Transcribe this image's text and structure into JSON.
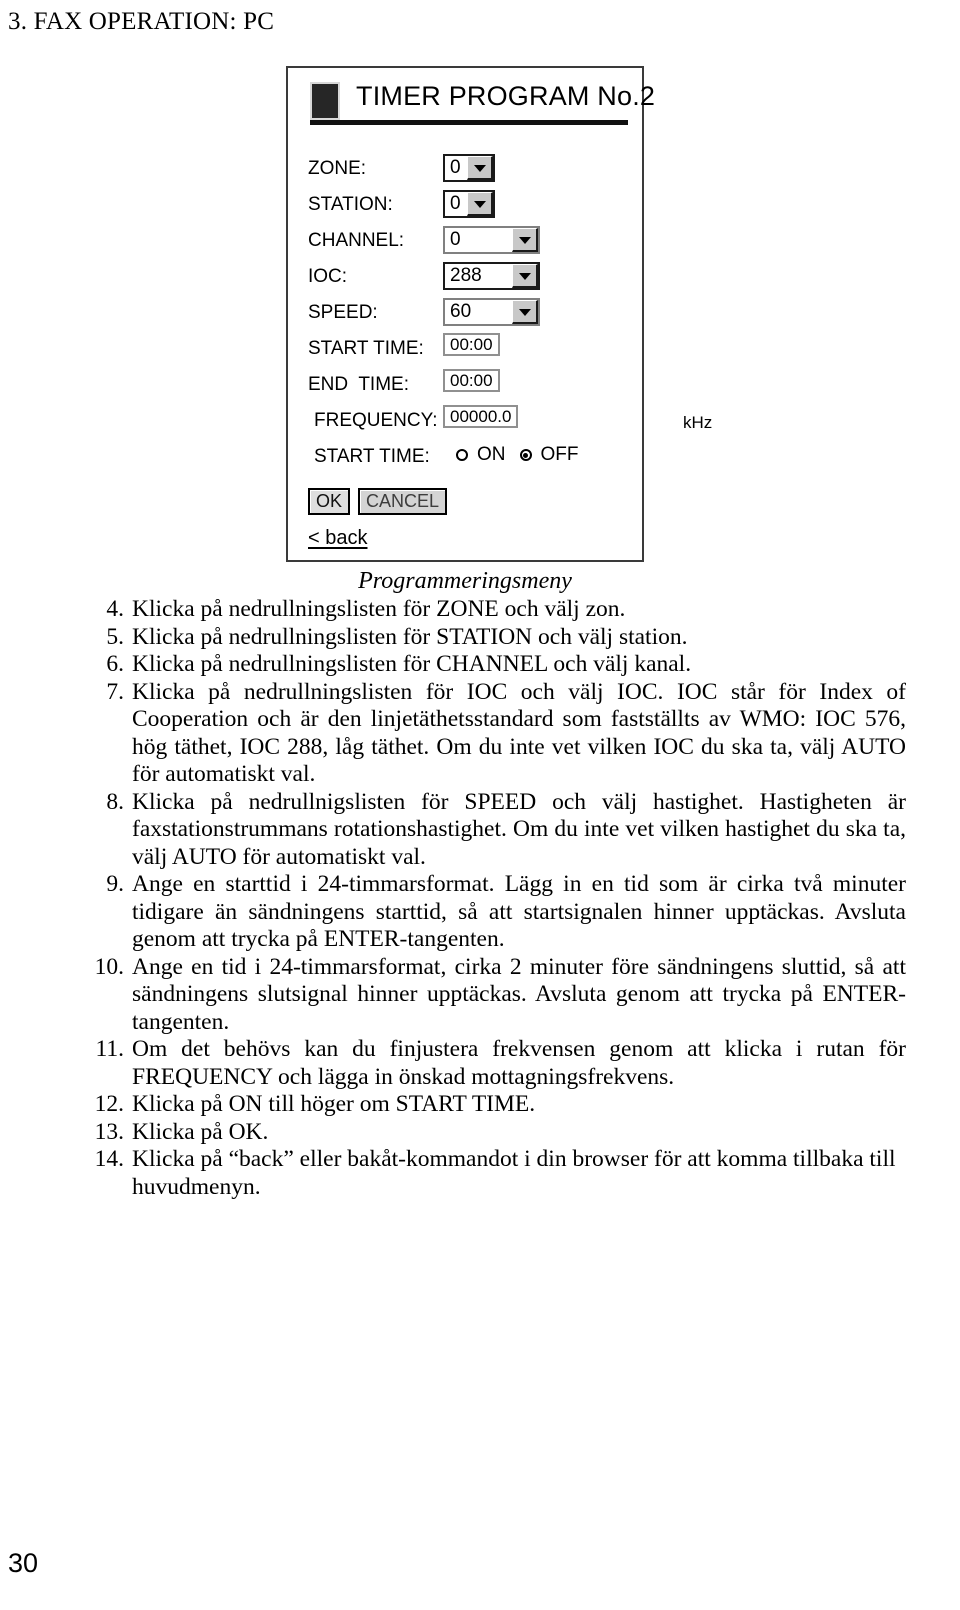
{
  "running_head": "3. FAX OPERATION: PC",
  "dialog": {
    "title": "TIMER PROGRAM No.2",
    "fields": [
      {
        "label": "ZONE:",
        "value": "0",
        "type": "combo-sm"
      },
      {
        "label": "STATION:",
        "value": "0",
        "type": "combo-sm"
      },
      {
        "label": "CHANNEL:",
        "value": "0",
        "type": "combo-lg"
      },
      {
        "label": "IOC:",
        "value": "288",
        "type": "combo-lg"
      },
      {
        "label": "SPEED:",
        "value": "60",
        "type": "combo-lg"
      },
      {
        "label": "START TIME:",
        "value": "00:00",
        "type": "textbox-time"
      },
      {
        "label": "END  TIME:",
        "value": "00:00",
        "type": "textbox-time"
      },
      {
        "label": "FREQUENCY:",
        "value": "00000.0",
        "unit": "kHz",
        "type": "textbox-freq"
      }
    ],
    "radio_row": {
      "label": "START TIME:",
      "options": [
        {
          "label": "ON",
          "selected": false
        },
        {
          "label": "OFF",
          "selected": true
        }
      ]
    },
    "buttons": {
      "ok": "OK",
      "cancel": "CANCEL"
    },
    "back_link": "< back"
  },
  "caption": "Programmeringsmeny",
  "steps": [
    {
      "num": "4.",
      "text": "Klicka på nedrullningslisten för ZONE och välj zon."
    },
    {
      "num": "5.",
      "text": "Klicka på nedrullningslisten för STATION och välj station."
    },
    {
      "num": "6.",
      "text": "Klicka på nedrullningslisten för CHANNEL och välj kanal."
    },
    {
      "num": "7.",
      "text": "Klicka på nedrullningslisten för IOC och välj IOC. IOC står för Index of Cooperation och är den linjetäthetsstandard som fastställts av WMO: IOC 576, hög täthet, IOC 288, låg täthet. Om du inte vet vilken IOC du ska ta, välj AUTO för automatiskt val."
    },
    {
      "num": "8.",
      "text": "Klicka på nedrullnigslisten för SPEED och välj hastighet. Hastigheten är faxstationstrummans rotationshastighet. Om du inte vet vilken hastighet du ska ta, välj AUTO för automatiskt val."
    },
    {
      "num": "9.",
      "text": "Ange en starttid i 24-timmarsformat. Lägg in en tid som är cirka två minuter tidigare än sändningens starttid, så att startsignalen hinner upptäckas. Avsluta genom att trycka på ENTER-tangenten."
    },
    {
      "num": "10.",
      "text": "Ange en tid i 24-timmarsformat, cirka 2 minuter före sändningens sluttid, så att sändningens slutsignal hinner upptäckas. Avsluta genom att trycka på ENTER-tangenten."
    },
    {
      "num": "11.",
      "text": "Om det behövs kan du finjustera frekvensen genom att klicka i rutan för FREQUENCY och lägga in önskad mottagningsfrekvens."
    },
    {
      "num": "12.",
      "text": "Klicka på ON till höger om START TIME."
    },
    {
      "num": "13.",
      "text": "Klicka på OK."
    },
    {
      "num": "14.",
      "text": "Klicka på “back” eller bakåt-kommandot i din browser för att komma tillbaka till huvudmenyn."
    }
  ],
  "folio": "30"
}
